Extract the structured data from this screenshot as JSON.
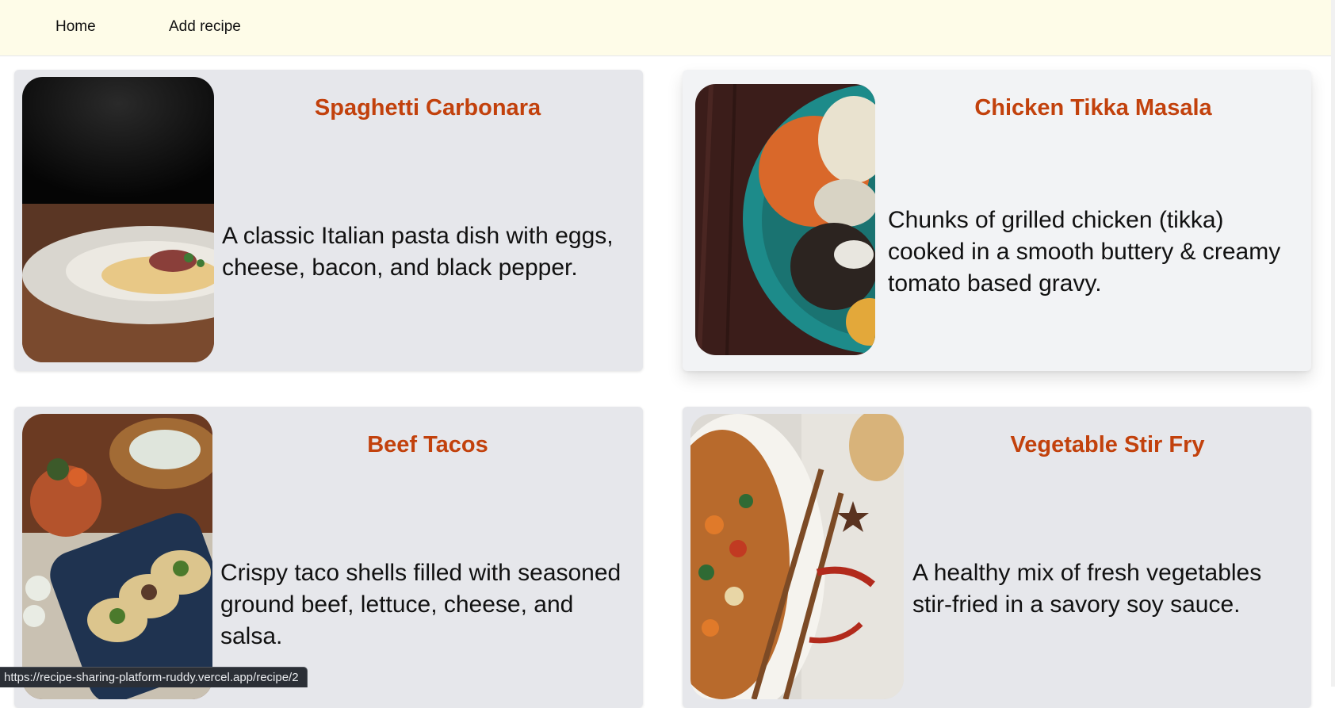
{
  "nav": {
    "home_label": "Home",
    "add_recipe_label": "Add recipe"
  },
  "recipes": [
    {
      "title": "Spaghetti Carbonara",
      "description": "A classic Italian pasta dish with eggs, cheese, bacon, and black pepper."
    },
    {
      "title": "Chicken Tikka Masala",
      "description": "Chunks of grilled chicken (tikka) cooked in a smooth buttery & creamy tomato based gravy."
    },
    {
      "title": "Beef Tacos",
      "description": "Crispy taco shells filled with seasoned ground beef, lettuce, cheese, and salsa."
    },
    {
      "title": "Vegetable Stir Fry",
      "description": "A healthy mix of fresh vegetables stir-fried in a savory soy sauce."
    }
  ],
  "status_bar": {
    "url": "https://recipe-sharing-platform-ruddy.vercel.app/recipe/2"
  },
  "colors": {
    "navbar_bg": "#fefce8",
    "card_bg": "#e6e7eb",
    "title_color": "#c2410c"
  }
}
